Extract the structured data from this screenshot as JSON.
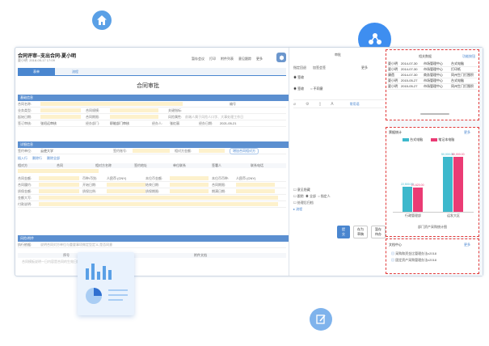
{
  "colors": {
    "accent": "#4a86cf",
    "blue": "#5aa0e6",
    "teal": "#3db8cc",
    "pink": "#ea3b74",
    "dash": "#e23b3b"
  },
  "icons": {
    "home": "home-icon",
    "share": "share-icon",
    "edit": "edit-icon",
    "drive": "drive-icon"
  },
  "header": {
    "title": "合同评审--支出合同-夏小明",
    "meta_user": "夏小明",
    "meta_time": "2018-05-17 17:09",
    "tabs": [
      "表单",
      "流程"
    ],
    "actions": [
      "暂存会议",
      "打印",
      "附件列表",
      "意见跟踪",
      "更多"
    ]
  },
  "form": {
    "title": "合同审批",
    "sections": [
      "基础信息",
      "详细信息",
      "风险/附件"
    ],
    "basic_rows": [
      [
        "合同名称:",
        "",
        "编号"
      ],
      [
        "业务类型:",
        "",
        "合同规模:",
        "",
        "关键指标:"
      ],
      [
        "起始日期:",
        "",
        "合同期限:",
        "",
        "风险属性:",
        "前端人属于风险人口字、大事处理工作日"
      ],
      [
        "签订审核:",
        "张绍远审核",
        "",
        "经办部门:",
        "职能部门审核",
        "经办人:",
        "张红丽",
        "经办日期:",
        "2021-05-21"
      ]
    ],
    "detail": {
      "party_label": "签约单位:",
      "party_value": "云使大学",
      "account_label": "签约账号:",
      "amount_label": "相对方金额:",
      "fill_link": "增加合同相对方",
      "buttons": [
        "插入行",
        "删除行",
        "删除全部"
      ],
      "columns": [
        "相对方",
        "合同",
        "相对方名称",
        "签约地址",
        "单位联系",
        "签署人",
        "联系电话"
      ],
      "rows": [
        [
          "合同金额:",
          "",
          "币种/币别:",
          "人民币 (CNY)",
          "本位币金额:",
          "",
          "本位币币种:",
          "人民币 (CNY)"
        ],
        [
          "合同履约:",
          "",
          "开始日期:",
          "",
          "结束日期:",
          "",
          "合同期限:",
          ""
        ],
        [
          "质保金额:",
          "",
          "质保比例:",
          "",
          "质保期限:",
          "",
          "期满日期:",
          ""
        ],
        [
          "金额大写:",
          "",
          "",
          "",
          "",
          "",
          "",
          ""
        ],
        [
          "付款说明:",
          "",
          "",
          "",
          "",
          "",
          "",
          ""
        ]
      ]
    },
    "risk": {
      "label1": "执行依据:",
      "value1": "说明合同对方单位与重要事项做定型定义,是否同意",
      "col1": "序号",
      "col2": "附件文档",
      "hint": "合同模板说明一日内容是合同的生效日期"
    }
  },
  "approval": {
    "header": "审批",
    "toolbar": [
      "指定回退",
      "加签会签",
      "更多"
    ],
    "radios": [
      "签收",
      "不同意"
    ],
    "checks": [
      "意见隐藏",
      "跟踪",
      "全部",
      "指定人",
      "处理后归档"
    ],
    "link": "常用语",
    "more_link": "更多",
    "footer_link": "流程",
    "buttons": [
      "提交",
      "存为草稿",
      "暂存待办"
    ]
  },
  "related": {
    "header": "相关数据",
    "link": "功能按钮",
    "rows": [
      [
        "夏小明",
        "2014-07-30",
        "市场管理中心",
        "台式电脑"
      ],
      [
        "夏小明",
        "2014-07-30",
        "市场管理中心",
        "打印纸"
      ],
      [
        "康蓓",
        "2014-07-30",
        "商务管理中心",
        "同州生门打围积"
      ],
      [
        "夏小明",
        "2015-05-27",
        "市场管理中心",
        "台式电脑"
      ],
      [
        "夏小明",
        "2015-05-27",
        "市场管理中心",
        "同州生门打围积"
      ]
    ]
  },
  "chart_data": {
    "type": "bar",
    "title": "票据统计",
    "more": "更多",
    "categories": [
      "行政管理部",
      "运发大区"
    ],
    "series": [
      {
        "name": "台式电脑",
        "values": [
          22500.0,
          50000.0
        ]
      },
      {
        "name": "笔记本电脑",
        "values": [
          21620.0,
          50000.0
        ]
      }
    ],
    "value_labels": [
      [
        "22,500.00",
        "21,620.00"
      ],
      [
        "50,000.00",
        "50,000.00"
      ]
    ],
    "xlabel": "部门资产采购统计图",
    "ylim": [
      0,
      60000
    ]
  },
  "docs": {
    "title": "文档中心",
    "more": "更多",
    "items": [
      "采购和资金比管理办法v2018",
      "固定资产采购管理办法v2018"
    ]
  }
}
